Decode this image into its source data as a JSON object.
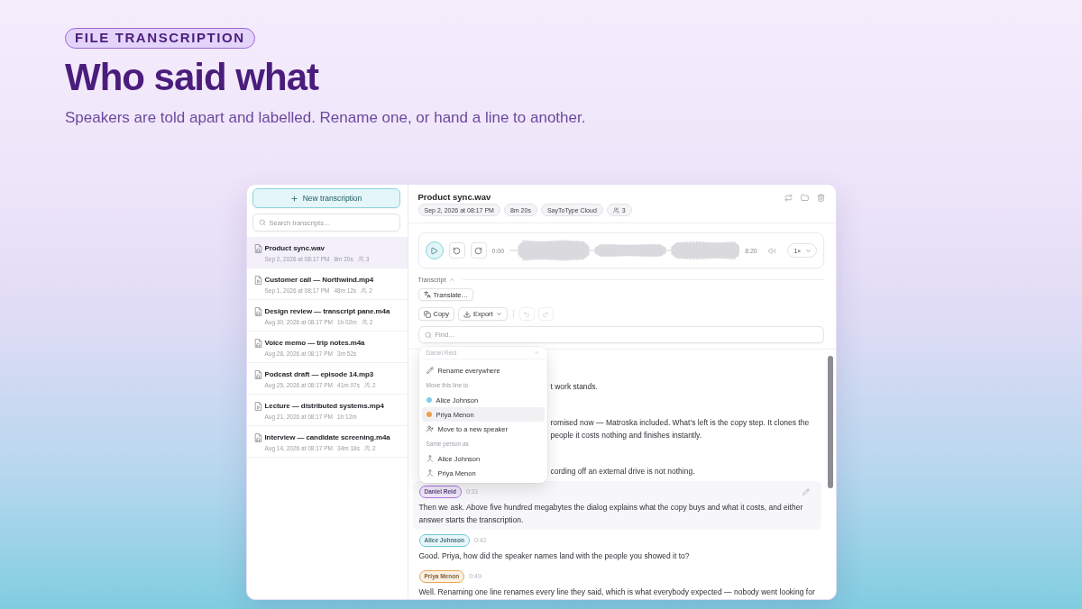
{
  "hero": {
    "eyebrow": "FILE TRANSCRIPTION",
    "title": "Who said what",
    "subtitle": "Speakers are told apart and labelled. Rename one, or hand a line to another."
  },
  "sidebar": {
    "new_button": "New transcription",
    "search": {
      "placeholder": "Search transcripts…"
    },
    "items": [
      {
        "kind": "audio",
        "title": "Product sync.wav",
        "date": "Sep 2, 2026 at 08:17 PM",
        "duration": "8m 20s",
        "speakers": "3",
        "selected": true
      },
      {
        "kind": "video",
        "title": "Customer call — Northwind.mp4",
        "date": "Sep 1, 2026 at 08:17 PM",
        "duration": "48m 12s",
        "speakers": "2",
        "selected": false
      },
      {
        "kind": "audio",
        "title": "Design review — transcript pane.m4a",
        "date": "Aug 30, 2026 at 08:17 PM",
        "duration": "1h 02m",
        "speakers": "2",
        "selected": false
      },
      {
        "kind": "audio",
        "title": "Voice memo — trip notes.m4a",
        "date": "Aug 28, 2026 at 08:17 PM",
        "duration": "3m 52s",
        "selected": false
      },
      {
        "kind": "audio",
        "title": "Podcast draft — episode 14.mp3",
        "date": "Aug 25, 2026 at 08:17 PM",
        "duration": "41m 07s",
        "speakers": "2",
        "selected": false
      },
      {
        "kind": "video",
        "title": "Lecture — distributed systems.mp4",
        "date": "Aug 21, 2026 at 08:17 PM",
        "duration": "1h 12m",
        "selected": false
      },
      {
        "kind": "audio",
        "title": "Interview — candidate screening.m4a",
        "date": "Aug 14, 2026 at 08:17 PM",
        "duration": "34m 18s",
        "speakers": "2",
        "selected": false
      }
    ]
  },
  "file": {
    "title": "Product sync.wav",
    "chips": [
      {
        "kind": "text",
        "label": "Sep 2, 2026 at 08:17 PM"
      },
      {
        "kind": "text",
        "label": "8m 20s"
      },
      {
        "kind": "text",
        "label": "SayToType Cloud"
      },
      {
        "kind": "speakers",
        "label": "3"
      }
    ]
  },
  "player": {
    "playing": false,
    "elapsed": "0:00",
    "total": "8:20",
    "speed": "1×"
  },
  "transcript_tools": {
    "label": "Transcript",
    "expanded": true,
    "translate": "Translate…",
    "copy": "Copy",
    "export": "Export",
    "undo_disabled": true,
    "redo_disabled": true,
    "find": {
      "placeholder": "Find…"
    }
  },
  "speaker_menu": {
    "title": "Daniel Reid",
    "actions": [
      {
        "kind": "rename",
        "label": "Rename everywhere",
        "highlighted": false
      }
    ],
    "groups": [
      {
        "heading": "Move this line to",
        "items": [
          {
            "kind": "speaker",
            "label": "Alice Johnson",
            "color": "#7fd0e3",
            "highlighted": false
          },
          {
            "kind": "speaker",
            "label": "Priya Menon",
            "color": "#eda048",
            "highlighted": true
          },
          {
            "kind": "new_speaker",
            "label": "Move to a new speaker",
            "highlighted": false
          }
        ]
      },
      {
        "heading": "Same person as",
        "items": [
          {
            "kind": "merge",
            "label": "Alice Johnson",
            "highlighted": false
          },
          {
            "kind": "merge",
            "label": "Priya Menon",
            "highlighted": false
          }
        ]
      }
    ]
  },
  "transcript": {
    "rows": [
      {
        "kind": "covered",
        "lines": [
          "t work stands."
        ]
      },
      {
        "kind": "covered",
        "lines": [
          "romised now — Matroska included. What’s left is the copy step. It clones the",
          "people it costs nothing and finishes instantly."
        ]
      },
      {
        "kind": "covered",
        "lines": [
          "cording off an external drive is not nothing."
        ]
      },
      {
        "kind": "line",
        "speaker": "Daniel Reid",
        "color": "#a875e0",
        "time": "0:31",
        "hovered": true,
        "lines": [
          "Then we ask. Above five hundred megabytes the dialog explains what the copy buys and what it costs, and either",
          "answer starts the transcription."
        ]
      },
      {
        "kind": "line",
        "speaker": "Alice Johnson",
        "color": "#6fc9da",
        "time": "0:42",
        "hovered": false,
        "lines": [
          "Good. Priya, how did the speaker names land with the people you showed it to?"
        ]
      },
      {
        "kind": "line",
        "speaker": "Priya Menon",
        "color": "#eba552",
        "time": "0:49",
        "hovered": false,
        "lines": [
          "Well. Renaming one line renames every line they said, which is what everybody expected — nobody went looking for"
        ]
      }
    ]
  }
}
